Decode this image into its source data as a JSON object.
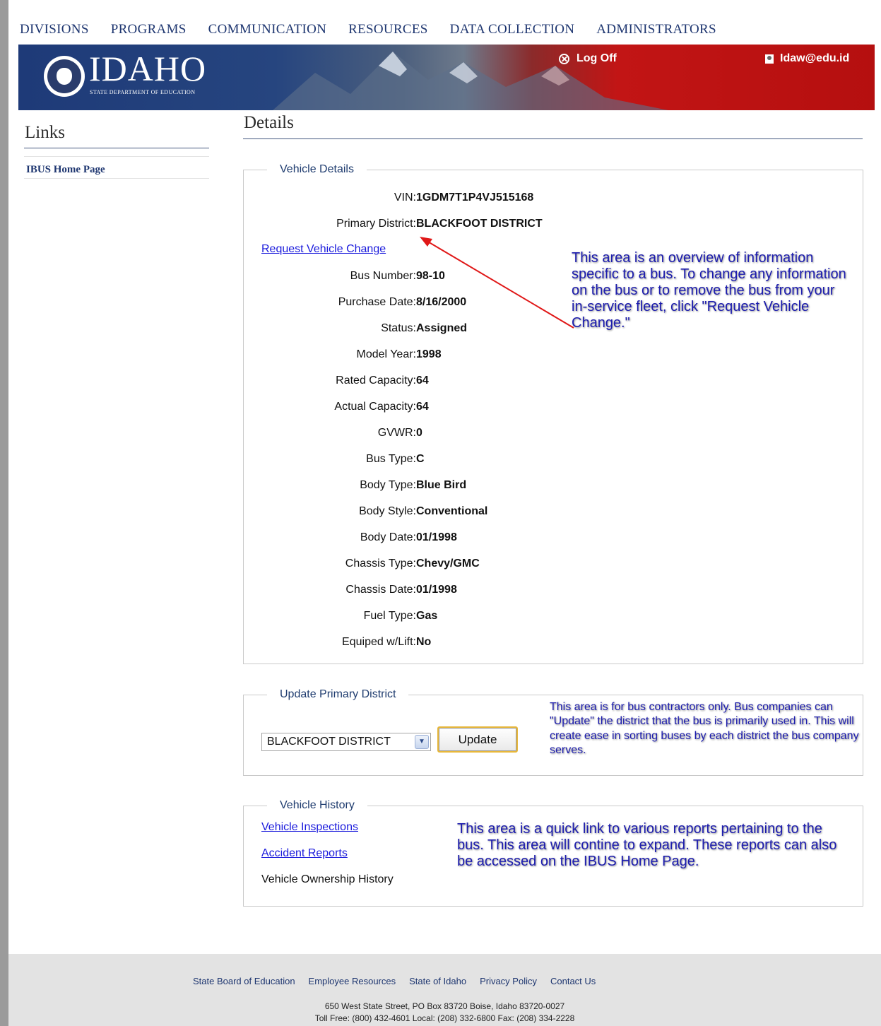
{
  "nav": [
    "DIVISIONS",
    "PROGRAMS",
    "COMMUNICATION",
    "RESOURCES",
    "DATA COLLECTION",
    "ADMINISTRATORS"
  ],
  "header": {
    "brand": "IDAHO",
    "brand_sub": "STATE DEPARTMENT OF EDUCATION",
    "logoff": "Log Off",
    "user": "Idaw@edu.id"
  },
  "sidebar": {
    "title": "Links",
    "items": [
      "IBUS Home Page"
    ]
  },
  "page_title": "Details",
  "vehicle_details": {
    "legend": "Vehicle Details",
    "fields_top": [
      {
        "label": "VIN:",
        "value": "1GDM7T1P4VJ515168"
      },
      {
        "label": "Primary District:",
        "value": "BLACKFOOT DISTRICT"
      }
    ],
    "request_link": "Request Vehicle Change",
    "fields": [
      {
        "label": "Bus Number:",
        "value": "98-10"
      },
      {
        "label": "Purchase Date:",
        "value": "8/16/2000"
      },
      {
        "label": "Status:",
        "value": "Assigned"
      },
      {
        "label": "Model Year:",
        "value": "1998"
      },
      {
        "label": "Rated Capacity:",
        "value": "64"
      },
      {
        "label": "Actual Capacity:",
        "value": "64"
      },
      {
        "label": "GVWR:",
        "value": "0"
      },
      {
        "label": "Bus Type:",
        "value": "C"
      },
      {
        "label": "Body Type:",
        "value": "Blue Bird"
      },
      {
        "label": "Body Style:",
        "value": "Conventional"
      },
      {
        "label": "Body Date:",
        "value": "01/1998"
      },
      {
        "label": "Chassis Type:",
        "value": "Chevy/GMC"
      },
      {
        "label": "Chassis Date:",
        "value": "01/1998"
      },
      {
        "label": "Fuel Type:",
        "value": "Gas"
      },
      {
        "label": "Equiped w/Lift:",
        "value": "No"
      }
    ],
    "note": "This area is an overview of information specific to a bus.  To change any information on the bus or to remove the bus from your in-service fleet, click \"Request Vehicle Change.\""
  },
  "update_district": {
    "legend": "Update Primary District",
    "selected": "BLACKFOOT DISTRICT",
    "button": "Update",
    "note": "This area is for bus contractors only.  Bus companies can \"Update\" the district that the bus is primarily used in.  This will create ease in sorting buses by each district the bus company serves."
  },
  "vehicle_history": {
    "legend": "Vehicle History",
    "links": [
      "Vehicle Inspections",
      "Accident Reports"
    ],
    "text": "Vehicle Ownership History",
    "note": "This area is a quick link to various reports pertaining to the bus.  This area will contine to expand.  These reports can also be accessed on the IBUS Home Page."
  },
  "footer": {
    "links": [
      "State Board of Education",
      "Employee Resources",
      "State of Idaho",
      "Privacy Policy",
      "Contact Us"
    ],
    "address": "650 West State Street, PO Box 83720 Boise, Idaho 83720-0027",
    "phones": "Toll Free: (800) 432-4601 Local: (208) 332-6800 Fax: (208) 334-2228"
  },
  "colors": {
    "nav": "#1e3670",
    "banner_blue": "#1e3a78",
    "banner_red": "#c21515",
    "note_text": "#1c1cae",
    "link": "#1a1adc"
  },
  "icons": [
    "idaho-seal-icon",
    "close-circle-icon",
    "user-icon",
    "chevron-down-icon",
    "arrow-icon"
  ]
}
